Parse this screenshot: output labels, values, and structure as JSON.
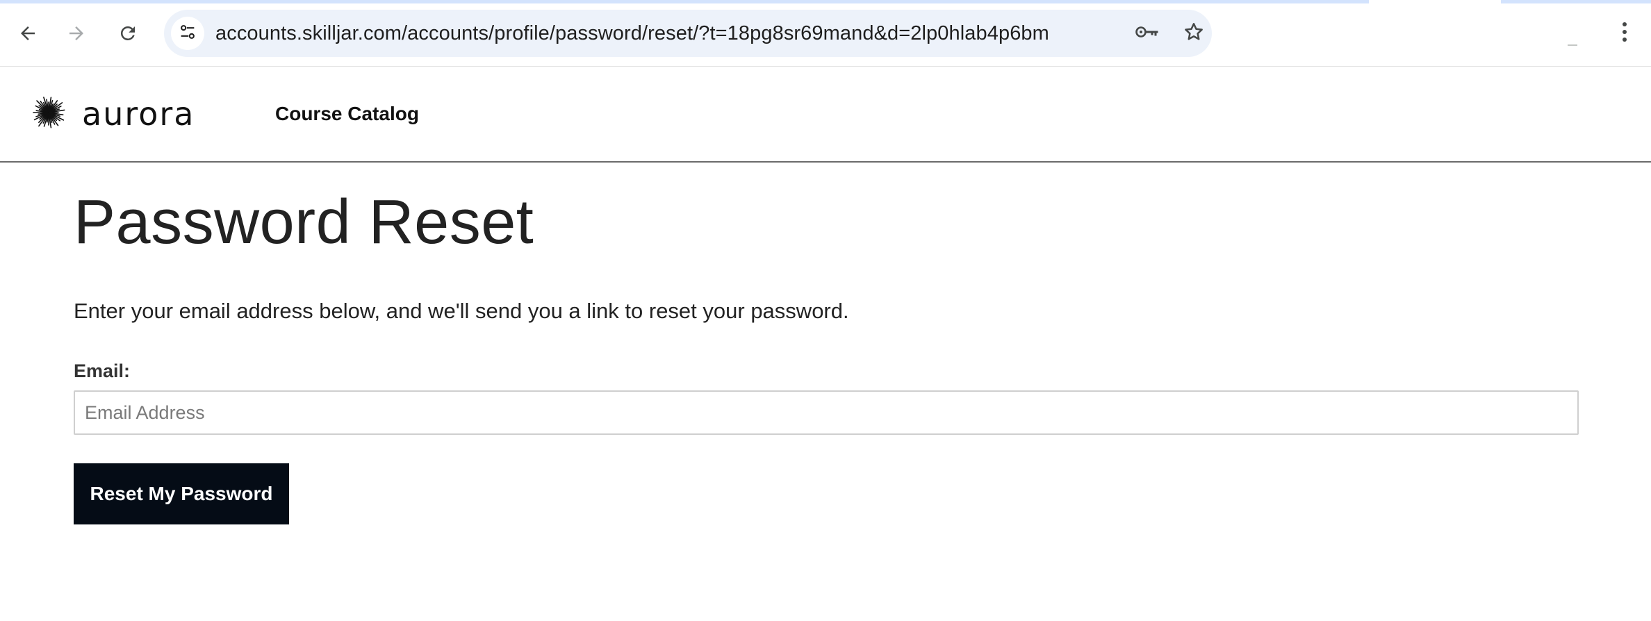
{
  "browser": {
    "url": "accounts.skilljar.com/accounts/profile/password/reset/?t=18pg8sr69mand&d=2lp0hlab4p6bm",
    "icons": {
      "back": "arrow-left-icon",
      "forward": "arrow-right-icon",
      "reload": "reload-icon",
      "site_info": "tune-icon",
      "password_key": "key-icon",
      "bookmark": "star-icon",
      "menu": "kebab-menu-icon"
    }
  },
  "header": {
    "logo_text": "aurora",
    "nav": [
      {
        "label": "Course Catalog"
      }
    ]
  },
  "main": {
    "title": "Password Reset",
    "intro": "Enter your email address below, and we'll send you a link to reset your password.",
    "email_label": "Email:",
    "email_value": "",
    "email_placeholder": "Email Address",
    "submit_label": "Reset My Password"
  },
  "colors": {
    "omnibox_bg": "#edf2fa",
    "button_bg": "#050c16",
    "header_divider": "#6b6b6b"
  }
}
